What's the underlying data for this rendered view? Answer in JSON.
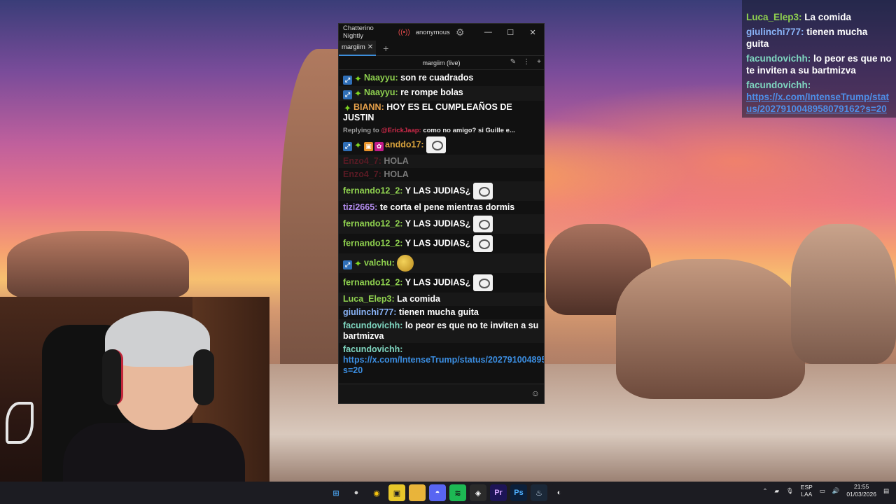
{
  "window": {
    "app_title": "Chatterino Nightly",
    "user": "anonymous",
    "tab_label": "margiim",
    "split_title": "margiim (live)"
  },
  "messages": [
    {
      "badges": [
        "mod",
        "sparkle"
      ],
      "name": "Naayyu",
      "name_color": "#8fd14f",
      "text": "son re cuadrados"
    },
    {
      "badges": [
        "mod",
        "sparkle"
      ],
      "name": "Naayyu",
      "name_color": "#8fd14f",
      "text": "re rompe bolas"
    },
    {
      "badges": [
        "sparkle"
      ],
      "name": "BIANN",
      "name_color": "#e6a04a",
      "text": "HOY ES EL CUMPLEAÑOS DE JUSTIN"
    },
    {
      "reply_prefix": "Replying to",
      "reply_user": "@ErickJaap:",
      "reply_text": "como no amigo? si Guille e..."
    },
    {
      "badges": [
        "mod",
        "sparkle",
        "sub",
        "pink"
      ],
      "name": "anddo17",
      "name_color": "#d8a23c",
      "text": "",
      "emote": true
    },
    {
      "name": "Enzo4_7",
      "name_color": "#5a1a24",
      "text": "HOLA",
      "dim": true
    },
    {
      "name": "Enzo4_7",
      "name_color": "#5a1a24",
      "text": "HOLA",
      "dim": true
    },
    {
      "name": "fernando12_2",
      "name_color": "#8fd14f",
      "text": "Y LAS JUDIAS¿",
      "emote": true
    },
    {
      "name": "tizi2665",
      "name_color": "#b48cf0",
      "text": "te corta el pene mientras dormis"
    },
    {
      "name": "fernando12_2",
      "name_color": "#8fd14f",
      "text": "Y LAS JUDIAS¿",
      "emote": true
    },
    {
      "name": "fernando12_2",
      "name_color": "#8fd14f",
      "text": "Y LAS JUDIAS¿",
      "emote": true
    },
    {
      "badges": [
        "mod",
        "sparkle"
      ],
      "name": "valchu",
      "name_color": "#8fd14f",
      "text": "",
      "emote_round": true
    },
    {
      "name": "fernando12_2",
      "name_color": "#8fd14f",
      "text": "Y LAS JUDIAS¿",
      "emote": true
    },
    {
      "name": "Luca_Elep3",
      "name_color": "#8fd14f",
      "text": "La comida"
    },
    {
      "name": "giulinchi777",
      "name_color": "#8ab4f8",
      "text": "tienen mucha guita"
    },
    {
      "name": "facundovichh",
      "name_color": "#7fd6c0",
      "text": "lo peor es que no te inviten a su bartmizva"
    },
    {
      "name": "facundovichh",
      "name_color": "#7fd6c0",
      "text": "https://x.com/IntenseTrump/status/2027910048958079162?s=20",
      "link": true
    }
  ],
  "overlay": [
    {
      "name": "Luca_Elep3:",
      "name_color": "#8fd14f",
      "text": "La comida"
    },
    {
      "name": "giulinchi777:",
      "name_color": "#8ab4f8",
      "text": "tienen mucha guita"
    },
    {
      "name": "facundovichh:",
      "name_color": "#7fd6c0",
      "text": "lo peor es que no te inviten a su bartmizva"
    },
    {
      "name": "facundovichh:",
      "name_color": "#7fd6c0",
      "text": "https://x.com/IntenseTrump/status/2027910048958079162?s=20",
      "link": true
    }
  ],
  "taskbar": {
    "apps": [
      {
        "icon": "windows-icon",
        "glyph": "⊞",
        "bg": "#1c1c22",
        "fg": "#4aa3f0"
      },
      {
        "icon": "obs-icon",
        "glyph": "●",
        "bg": "#1c1c22",
        "fg": "#d0d0d0"
      },
      {
        "icon": "chrome-icon",
        "glyph": "◉",
        "bg": "#1c1c22",
        "fg": "#f4c20d"
      },
      {
        "icon": "notes-icon",
        "glyph": "▣",
        "bg": "#e8c72a",
        "fg": "#1c1c22"
      },
      {
        "icon": "folder-icon",
        "glyph": "▬",
        "bg": "#e9b43a",
        "fg": "#e9b43a"
      },
      {
        "icon": "discord-icon",
        "glyph": "◓",
        "bg": "#5865f2",
        "fg": "#fff"
      },
      {
        "icon": "spotify-icon",
        "glyph": "≋",
        "bg": "#1db954",
        "fg": "#111"
      },
      {
        "icon": "app-icon",
        "glyph": "◈",
        "bg": "#2b2b2b",
        "fg": "#fff"
      },
      {
        "icon": "premiere-icon",
        "glyph": "Pr",
        "bg": "#1d1456",
        "fg": "#d6a6ff"
      },
      {
        "icon": "photoshop-icon",
        "glyph": "Ps",
        "bg": "#0b1f3a",
        "fg": "#4fb0ff"
      },
      {
        "icon": "steam-icon",
        "glyph": "♨",
        "bg": "#1b2838",
        "fg": "#cfe3f5"
      },
      {
        "icon": "chatterino-icon",
        "glyph": "◐",
        "bg": "#1c1c22",
        "fg": "#e6e6e6"
      }
    ],
    "lang_top": "ESP",
    "lang_bottom": "LAA",
    "time": "21:55",
    "date": "01/03/2026"
  }
}
